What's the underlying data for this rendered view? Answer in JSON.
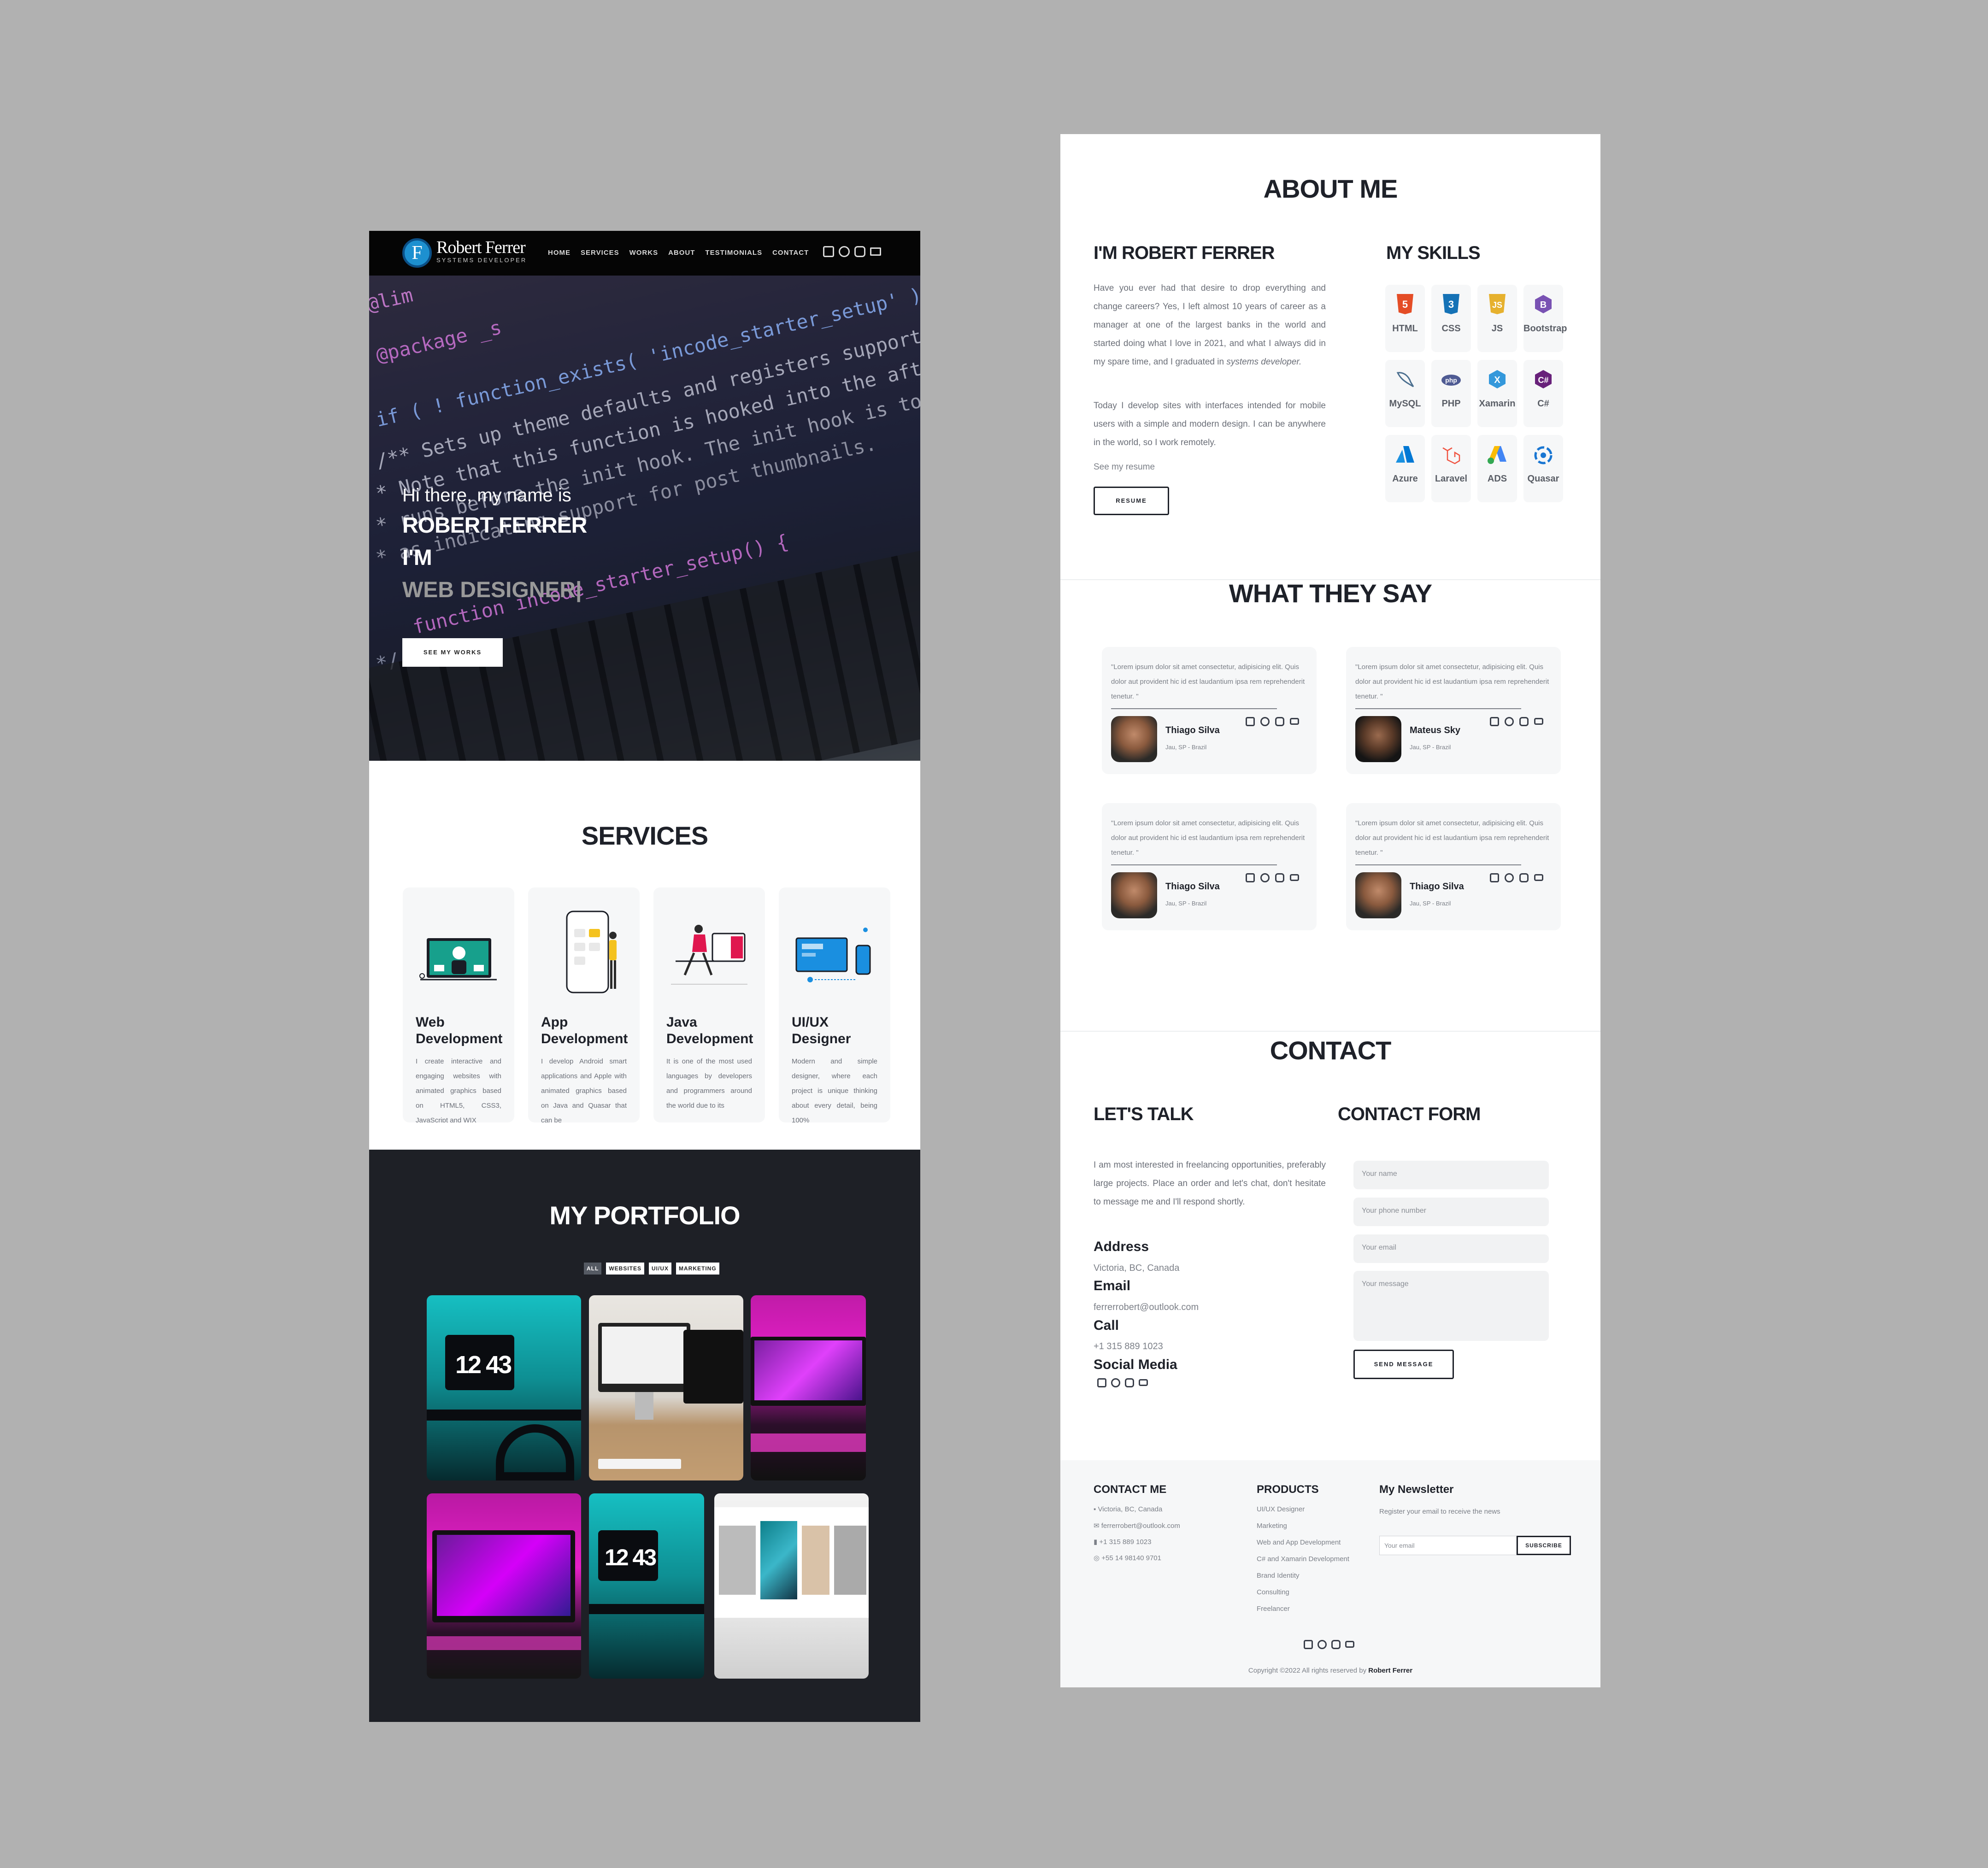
{
  "nav": {
    "logo_letter": "F",
    "logo_name": "Robert Ferrer",
    "logo_sub": "SYSTEMS DEVELOPER",
    "menu": [
      "HOME",
      "SERVICES",
      "WORKS",
      "ABOUT",
      "TESTIMONIALS",
      "CONTACT"
    ],
    "icons": [
      "linkedin-icon",
      "github-icon",
      "instagram-icon",
      "mail-icon"
    ]
  },
  "hero": {
    "greeting": "Hi there, my name is",
    "name": "ROBERT FERRER",
    "im": "I'M",
    "role": "WEB DESIGNER|",
    "cta": "SEE MY WORKS",
    "code_lines": [
      "@lim",
      "@package _s",
      "if ( ! function_exists( 'incode_starter_setup' ) ) :",
      "/** Sets up theme defaults and registers support for various",
      "* Note that this function is hooked into the after_setup_theme",
      "* runs before the init hook. The init hook is too late for",
      "* as indicating support for post thumbnails.",
      "function incode_starter_setup() {",
      "*/"
    ]
  },
  "services": {
    "title": "SERVICES",
    "items": [
      {
        "title": "Web Development",
        "desc": "I create interactive and engaging websites with animated graphics based on HTML5, CSS3, JavaScript and WIX"
      },
      {
        "title": "App Development",
        "desc": "I develop Android smart applications and Apple with animated graphics based on Java and Quasar that can be"
      },
      {
        "title": "Java Development",
        "desc": "It is one of the most used languages by developers and programmers around the world due to its"
      },
      {
        "title": "UI/UX Designer",
        "desc": "Modern and simple designer, where each project is unique thinking about every detail, being 100%"
      }
    ]
  },
  "portfolio": {
    "title": "MY PORTFOLIO",
    "filters": [
      "ALL",
      "WEBSITES",
      "UI/UX",
      "MARKETING"
    ],
    "clock_text": "12 43"
  },
  "about": {
    "title": "ABOUT ME",
    "heading": "I'M ROBERT FERRER",
    "p1": "Have you ever had that desire to drop everything and change careers? Yes, I left almost 10 years of career as a manager at one of the largest banks in the world and started doing what I love in 2021, and what I always did in my spare time, and I graduated in",
    "p1_em": "systems developer.",
    "p2": "Today I develop sites with interfaces intended for mobile users with a simple and modern design. I can be anywhere in the world, so I work remotely.",
    "resume_link": "See my resume",
    "resume_button": "RESUME",
    "skills_heading": "MY SKILLS",
    "skills": [
      "HTML",
      "CSS",
      "JS",
      "Bootstrap",
      "MySQL",
      "PHP",
      "Xamarin",
      "C#",
      "Azure",
      "Laravel",
      "ADS",
      "Quasar"
    ]
  },
  "testimonials": {
    "title": "WHAT THEY SAY",
    "items": [
      {
        "quote": "\"Lorem ipsum dolor sit amet consectetur, adipisicing elit. Quis dolor aut provident hic id est laudantium ipsa rem reprehenderit tenetur. \"",
        "name": "Thiago Silva",
        "loc": "Jau, SP - Brazil"
      },
      {
        "quote": "\"Lorem ipsum dolor sit amet consectetur, adipisicing elit. Quis dolor aut provident hic id est laudantium ipsa rem reprehenderit tenetur. \"",
        "name": "Mateus Sky",
        "loc": "Jau, SP - Brazil"
      },
      {
        "quote": "\"Lorem ipsum dolor sit amet consectetur, adipisicing elit. Quis dolor aut provident hic id est laudantium ipsa rem reprehenderit tenetur. \"",
        "name": "Thiago Silva",
        "loc": "Jau, SP - Brazil"
      },
      {
        "quote": "\"Lorem ipsum dolor sit amet consectetur, adipisicing elit. Quis dolor aut provident hic id est laudantium ipsa rem reprehenderit tenetur. \"",
        "name": "Thiago Silva",
        "loc": "Jau, SP - Brazil"
      }
    ]
  },
  "contact": {
    "title": "CONTACT",
    "talk_heading": "LET'S TALK",
    "talk_text": "I am most interested in freelancing opportunities, preferably large projects. Place an order and let's chat, don't hesitate to message me and I'll respond shortly.",
    "address_label": "Address",
    "address": "Victoria, BC, Canada",
    "email_label": "Email",
    "email": "ferrerrobert@outlook.com",
    "call_label": "Call",
    "phone": "+1 315 889 1023",
    "social_label": "Social Media",
    "form_heading": "CONTACT FORM",
    "name_placeholder": "Your name",
    "phone_placeholder": "Your phone number",
    "email_placeholder": "Your email",
    "message_placeholder": "Your message",
    "send": "SEND MESSAGE"
  },
  "footer": {
    "contact_heading": "CONTACT ME",
    "contact_items": [
      "Victoria, BC, Canada",
      "ferrerrobert@outlook.com",
      "+1 315 889 1023",
      "+55 14 98140 9701"
    ],
    "products_heading": "PRODUCTS",
    "products": [
      "UI/UX Designer",
      "Marketing",
      "Web and App Development",
      "C# and Xamarin Development",
      "Brand Identity",
      "Consulting",
      "Freelancer"
    ],
    "newsletter_heading": "My Newsletter",
    "newsletter_text": "Register your email to receive the news",
    "newsletter_placeholder": "Your email",
    "subscribe": "SUBSCRIBE",
    "copyright": "Copyright ©2022 All rights reserved by",
    "copyright_name": "Robert Ferrer"
  },
  "colors": {
    "background": "#b1b1b1",
    "dark": "#1e2026",
    "accent_cyan": "#19d3d6",
    "accent_magenta": "#e61fc8",
    "text": "#1e2129"
  }
}
